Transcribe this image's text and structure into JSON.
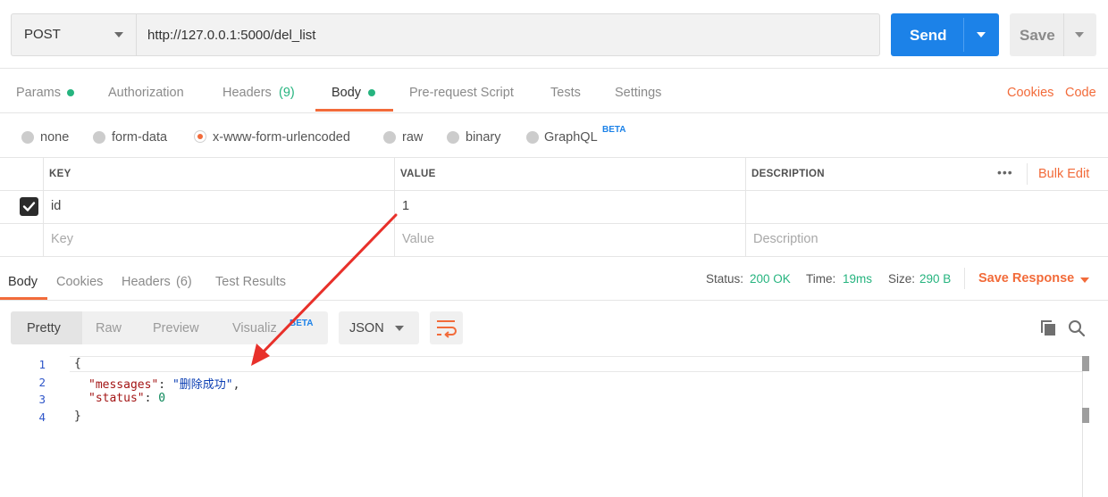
{
  "request": {
    "method": "POST",
    "url": "http://127.0.0.1:5000/del_list",
    "send_label": "Send",
    "save_label": "Save"
  },
  "request_tabs": {
    "params": "Params",
    "authorization": "Authorization",
    "headers": "Headers",
    "headers_count": "(9)",
    "body": "Body",
    "pre_request": "Pre-request Script",
    "tests": "Tests",
    "settings": "Settings",
    "cookies": "Cookies",
    "code": "Code"
  },
  "body_types": {
    "none": "none",
    "form_data": "form-data",
    "urlencoded": "x-www-form-urlencoded",
    "raw": "raw",
    "binary": "binary",
    "graphql": "GraphQL",
    "beta": "BETA",
    "selected": "x-www-form-urlencoded"
  },
  "params_table": {
    "headers": {
      "key": "KEY",
      "value": "VALUE",
      "description": "DESCRIPTION"
    },
    "more": "•••",
    "bulk_edit": "Bulk Edit",
    "rows": [
      {
        "checked": true,
        "key": "id",
        "value": "1",
        "description": ""
      }
    ],
    "placeholders": {
      "key": "Key",
      "value": "Value",
      "description": "Description"
    }
  },
  "response_tabs": {
    "body": "Body",
    "cookies": "Cookies",
    "headers": "Headers",
    "headers_count": "(6)",
    "test_results": "Test Results"
  },
  "response_meta": {
    "status_label": "Status:",
    "status_value": "200 OK",
    "time_label": "Time:",
    "time_value": "19ms",
    "size_label": "Size:",
    "size_value": "290 B",
    "save_response": "Save Response"
  },
  "view_modes": {
    "pretty": "Pretty",
    "raw": "Raw",
    "preview": "Preview",
    "visualize": "Visualiz",
    "beta": "BETA",
    "format": "JSON"
  },
  "response_body": {
    "line_numbers": [
      "1",
      "2",
      "3",
      "4"
    ],
    "open_brace": "{",
    "messages_key": "\"messages\"",
    "messages_value": "\"删除成功\"",
    "status_key": "\"status\"",
    "status_value": "0",
    "close_brace": "}"
  },
  "colors": {
    "accent_orange": "#f26b3a",
    "send_blue": "#1c82e8",
    "status_green": "#26b47f",
    "annotation_red": "#e8302a"
  }
}
